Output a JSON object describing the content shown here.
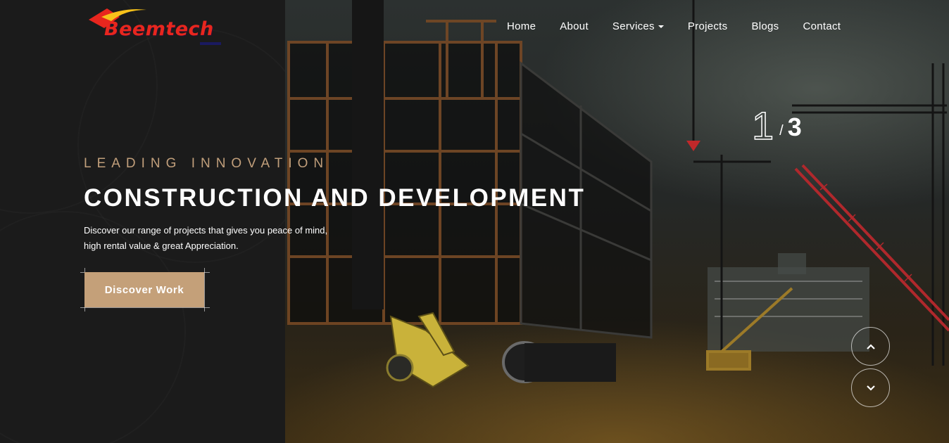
{
  "brand": {
    "logo_text": "Beemtech"
  },
  "nav": {
    "items": [
      {
        "label": "Home"
      },
      {
        "label": "About"
      },
      {
        "label": "Services"
      },
      {
        "label": "Projects"
      },
      {
        "label": "Blogs"
      },
      {
        "label": "Contact"
      }
    ]
  },
  "hero": {
    "eyebrow": "LEADING INNOVATION",
    "title": "CONSTRUCTION AND DEVELOPMENT",
    "description_line1": "Discover our range of projects that gives you peace of mind,",
    "description_line2": "high rental value & great Appreciation.",
    "cta_label": "Discover Work"
  },
  "slider": {
    "current": "1",
    "separator": "/",
    "total": "3",
    "prev_icon": "chevron-up-icon",
    "next_icon": "chevron-down-icon"
  },
  "colors": {
    "accent": "#c4a079",
    "eyebrow": "#c19f7b",
    "panel": "#1b1b1b",
    "logo_red": "#e8261e"
  }
}
